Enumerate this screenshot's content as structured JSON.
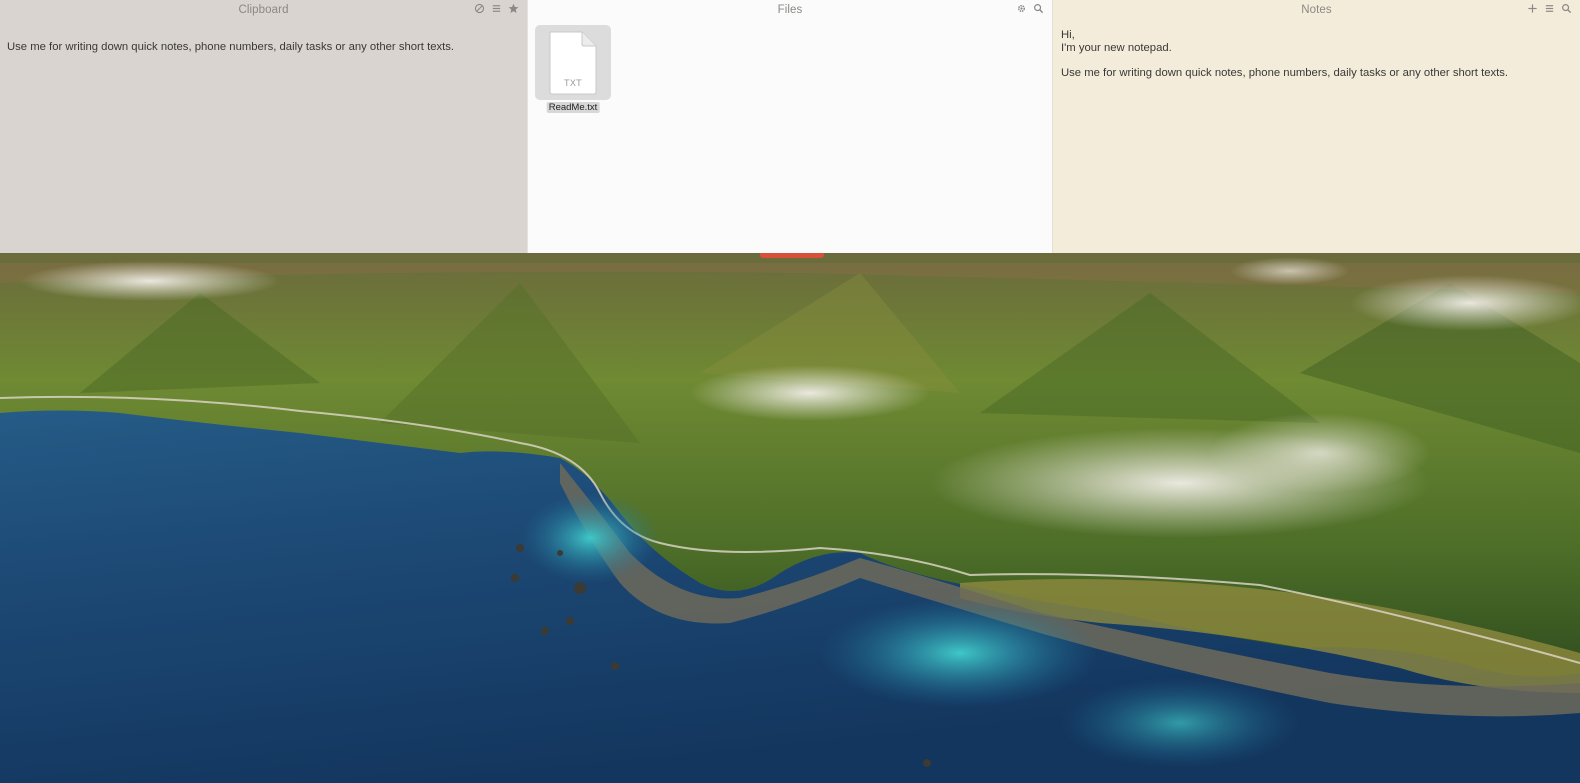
{
  "clipboard": {
    "title": "Clipboard",
    "tools": [
      "no-entry-icon",
      "list-icon",
      "star-icon"
    ],
    "item_text": "Use me for writing down quick notes, phone numbers, daily tasks or any other short texts."
  },
  "files": {
    "title": "Files",
    "tools": [
      "gear-icon",
      "search-icon"
    ],
    "items": [
      {
        "name": "ReadMe.txt",
        "ext": "TXT",
        "icon": "txt-file-icon"
      }
    ]
  },
  "notes": {
    "title": "Notes",
    "tools": [
      "plus-icon",
      "list-icon",
      "search-icon"
    ],
    "lines": [
      "Hi,",
      "I'm your new notepad.",
      "",
      "Use me for writing down quick notes, phone numbers, daily tasks or any other short texts."
    ]
  },
  "desktop": {
    "wallpaper": "coastline-mountains-wallpaper",
    "colors": {
      "ocean": "#1e4f7a",
      "shallow": "#2aa7b8",
      "hills": "#5e7a2e",
      "cloud": "#e9e6df"
    }
  },
  "colors": {
    "clipboard_bg": "#d9d4cf",
    "files_bg": "#fbfbfb",
    "notes_bg": "#f4ecdb",
    "accent": "#d7513a"
  }
}
